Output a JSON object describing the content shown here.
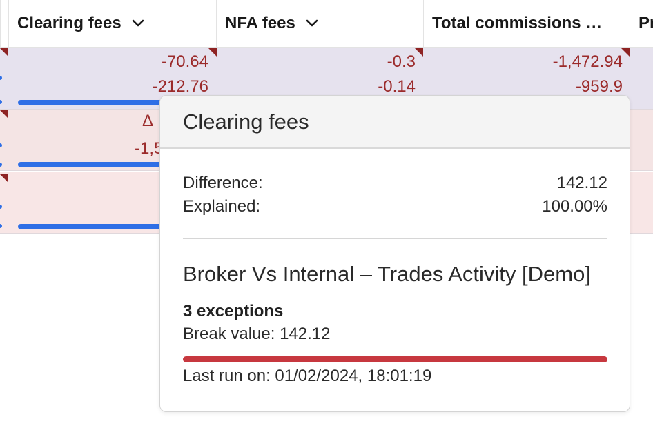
{
  "header": {
    "columns": [
      {
        "label": "Clearing fees"
      },
      {
        "label": "NFA fees"
      },
      {
        "label": "Total commissions …"
      },
      {
        "label": "Pr"
      }
    ]
  },
  "rows": [
    {
      "clearing": [
        "-70.64",
        "-212.76"
      ],
      "nfa": [
        "-0.3",
        "-0.14"
      ],
      "total": [
        "-1,472.94",
        "-959.9"
      ]
    },
    {
      "clearing_delta": "Δ",
      "clearing_partial": "-1,5"
    }
  ],
  "tooltip": {
    "title": "Clearing fees",
    "difference_label": "Difference:",
    "difference_value": "142.12",
    "explained_label": "Explained:",
    "explained_value": "100.00%",
    "report_title": "Broker Vs Internal – Trades Activity [Demo]",
    "exceptions": "3 exceptions",
    "break_value": "Break value: 142.12",
    "last_run": "Last run on: 01/02/2024, 18:01:19"
  },
  "colors": {
    "negative_text": "#9b2a2a",
    "progress_blue": "#2f6fe6",
    "break_bar_red": "#c7383f"
  },
  "icons": {
    "column_menu": "chevron-down-icon",
    "cell_flag": "red-corner-flag-icon"
  }
}
